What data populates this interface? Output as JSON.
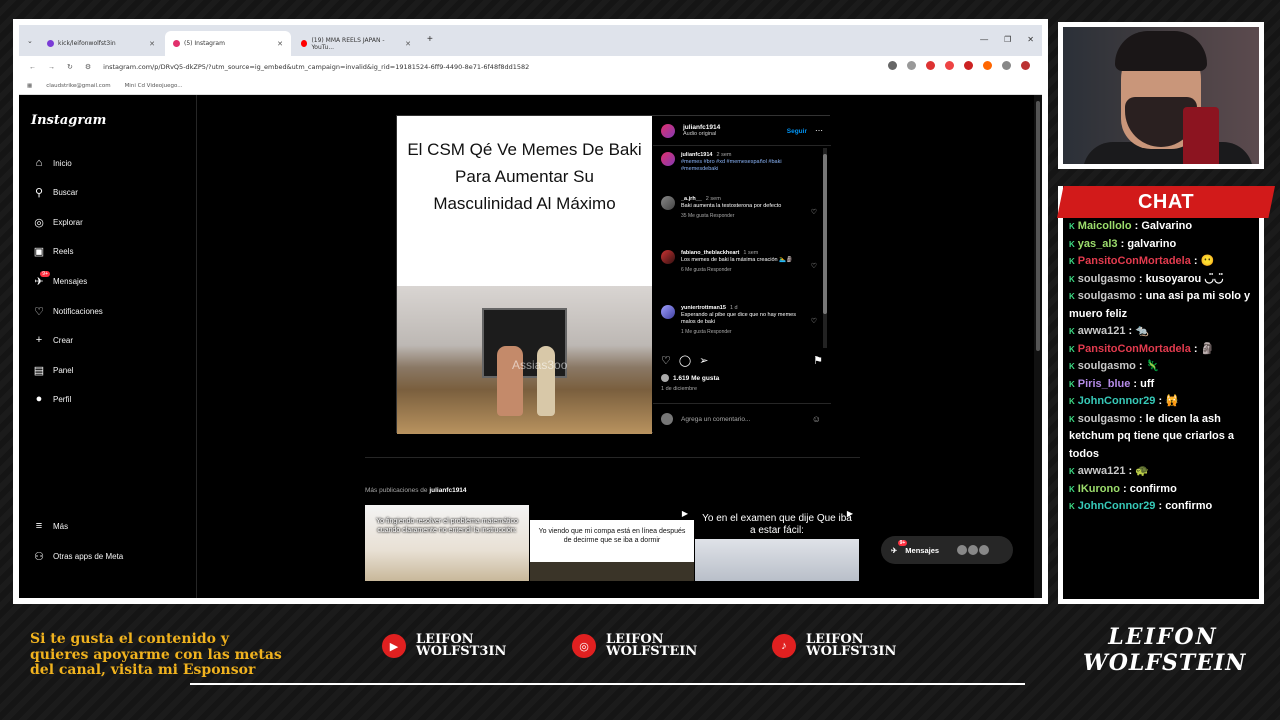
{
  "browser": {
    "tabs": [
      {
        "label": "kick/leifonwolfst3in",
        "favicon": "#7a3bd6"
      },
      {
        "label": "(5) Instagram",
        "favicon": "#e1306c"
      },
      {
        "label": "(19) MMA REELS JAPAN - YouTu...",
        "favicon": "#ff0000"
      }
    ],
    "new_tab": "+",
    "url": "instagram.com/p/DRvQ5-dkZP5/?utm_source=ig_embed&utm_campaign=invalid&ig_rid=19181524-6ff9-4490-8e71-6f48f8dd1582",
    "bookmarks": [
      "claudstrike@gmail.com",
      "Mini Cd Videojuego..."
    ]
  },
  "instagram": {
    "logo": "Instagram",
    "nav": [
      {
        "label": "Inicio",
        "icon": "home-icon"
      },
      {
        "label": "Buscar",
        "icon": "search-icon"
      },
      {
        "label": "Explorar",
        "icon": "compass-icon"
      },
      {
        "label": "Reels",
        "icon": "reels-icon"
      },
      {
        "label": "Mensajes",
        "icon": "messenger-icon",
        "badge": "9+"
      },
      {
        "label": "Notificaciones",
        "icon": "heart-icon"
      },
      {
        "label": "Crear",
        "icon": "plus-icon"
      },
      {
        "label": "Panel",
        "icon": "chart-icon"
      },
      {
        "label": "Perfil",
        "icon": "avatar-icon"
      }
    ],
    "bottom_nav": [
      {
        "label": "Más",
        "icon": "menu-icon"
      },
      {
        "label": "Otras apps de Meta",
        "icon": "meta-icon"
      }
    ],
    "post": {
      "meme_caption": "El CSM Qé Ve Memes De Baki Para Aumentar Su Masculinidad Al Máximo",
      "watermark": "Assias3oo",
      "author": "julianfc1914",
      "audio": "Audio original",
      "follow": "Seguir",
      "caption_user": "julianfc1914",
      "caption_time": "2 sem",
      "caption_tags": "#memes #bro #xd #memesespañol #baki #memesdebaki",
      "comments": [
        {
          "user": "_a.jrh__",
          "time": "2 sem",
          "text": "Baki aumenta la testosterona por defecto",
          "meta": "35 Me gusta   Responder"
        },
        {
          "user": "fabiano_theblackheart",
          "time": "1 sem",
          "text": "Los memes de baki la máxima creación 🏊‍♂️🗿",
          "meta": "6 Me gusta   Responder"
        },
        {
          "user": "yuniertrottman15",
          "time": "1 d",
          "text": "Esperando al pibe que dice que no hay memes malos de baki",
          "meta": "1 Me gusta   Responder"
        }
      ],
      "likes": "1.619 Me gusta",
      "date": "1 de diciembre",
      "add_comment_placeholder": "Agrega un comentario..."
    },
    "more": {
      "prefix": "Más publicaciones de",
      "user": "julianfc1914"
    },
    "thumbs": [
      "Yo fingiendo resolver el problema matemático cuando claramente no entendí la instrucción:",
      "Yo viendo que mi compa está en línea después de decirme que se iba a dormir",
      "Yo en el examen que dije Que iba a estar fácil:"
    ],
    "messages_pill": {
      "label": "Mensajes",
      "badge": "9+"
    }
  },
  "chat": {
    "title": "CHAT",
    "lines": [
      {
        "user": "Maicollolo",
        "cls": "nm-green",
        "msg": ": Galvarino"
      },
      {
        "user": "yas_al3",
        "cls": "nm-green",
        "msg": ": galvarino"
      },
      {
        "user": "PansitoConMortadela",
        "cls": "nm-red",
        "msg": ": 😶"
      },
      {
        "user": "soulgasmo",
        "cls": "nm-plain",
        "msg": ": kusoyarou ◡̈◡̈"
      },
      {
        "user": "soulgasmo",
        "cls": "nm-plain",
        "msg": ": una asi pa mi solo y muero feliz"
      },
      {
        "user": "awwa121",
        "cls": "nm-plain",
        "msg": ": 🐀"
      },
      {
        "user": "PansitoConMortadela",
        "cls": "nm-red",
        "msg": ": 🗿"
      },
      {
        "user": "soulgasmo",
        "cls": "nm-plain",
        "msg": ": 🦎"
      },
      {
        "user": "Piris_blue",
        "cls": "nm-purple",
        "msg": ": uff"
      },
      {
        "user": "JohnConnor29",
        "cls": "nm-teal",
        "msg": ": 🙀"
      },
      {
        "user": "soulgasmo",
        "cls": "nm-plain",
        "msg": ": le dicen la ash ketchum pq tiene que criarlos a todos"
      },
      {
        "user": "awwa121",
        "cls": "nm-plain",
        "msg": ": 🐢"
      },
      {
        "user": "IKurono",
        "cls": "nm-green",
        "msg": ": confirmo"
      },
      {
        "user": "JohnConnor29",
        "cls": "nm-teal",
        "msg": ": confirmo"
      }
    ]
  },
  "footer": {
    "sponsor_text": "Si te gusta el contenido y quieres apoyarme con las metas del canal, visita mi Esponsor",
    "socials": [
      {
        "icon": "youtube-icon",
        "line1": "LEIFON",
        "line2": "WOLFST3IN"
      },
      {
        "icon": "instagram-icon",
        "line1": "LEIFON",
        "line2": "WOLFSTEIN"
      },
      {
        "icon": "tiktok-icon",
        "line1": "LEIFON",
        "line2": "WOLFST3IN"
      }
    ],
    "brand_line1": "LEIFON",
    "brand_line2": "WOLFSTEIN"
  },
  "colors": {
    "accent_red": "#d21a1a",
    "sponsor_gold": "#f0b21e",
    "instagram_blue": "#0095f6"
  }
}
